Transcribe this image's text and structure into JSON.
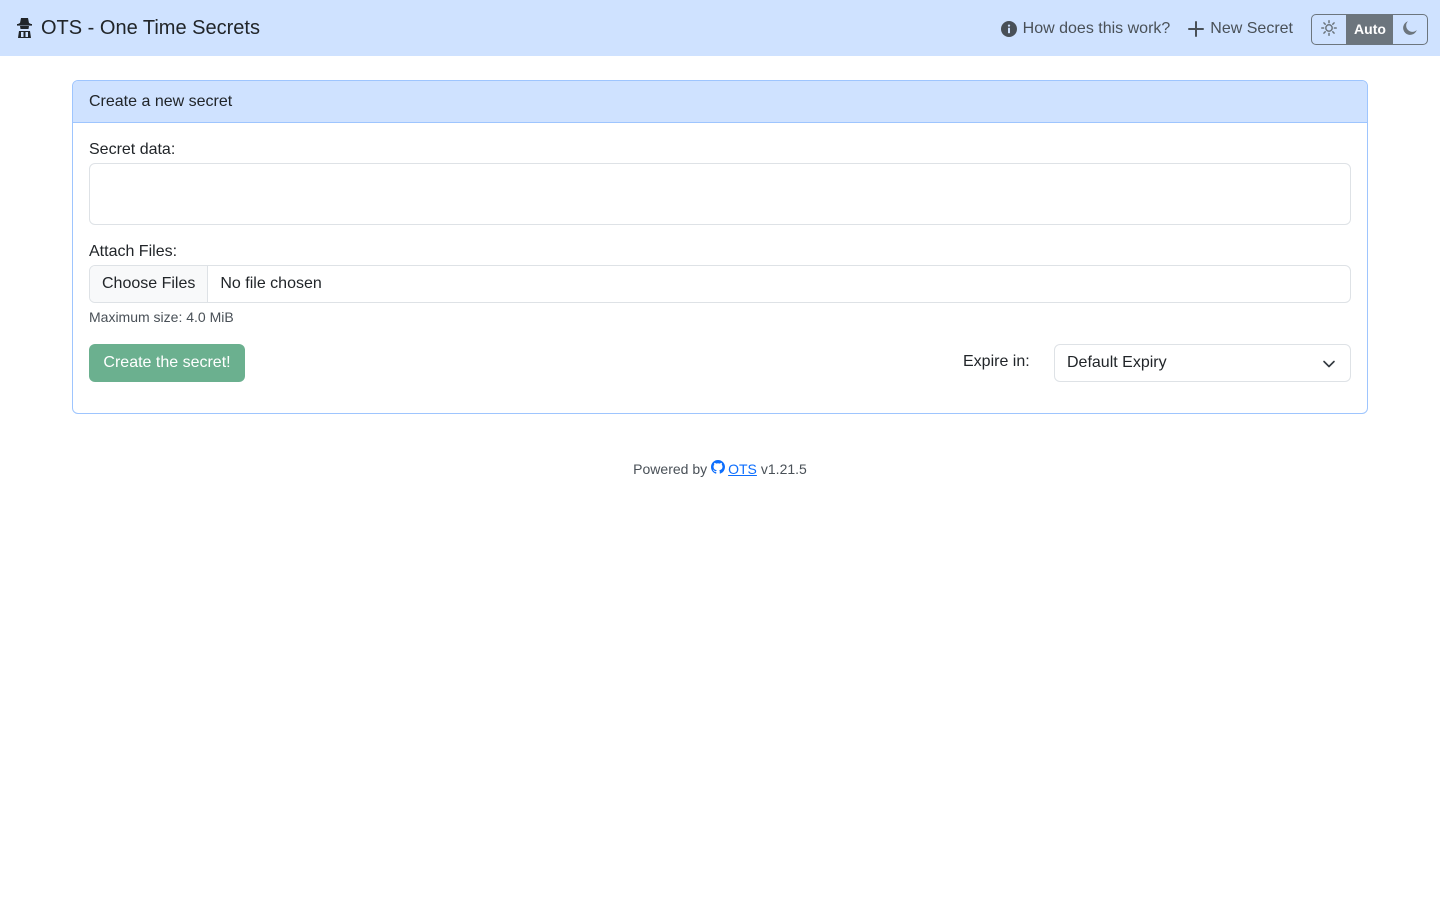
{
  "navbar": {
    "brand_icon": "spy-icon",
    "brand_title": "OTS - One Time Secrets",
    "how_label": "How does this work?",
    "how_icon": "info-circle-icon",
    "new_secret_label": "New Secret",
    "new_secret_icon": "plus-icon",
    "theme": {
      "light_icon": "sun-icon",
      "auto_label": "Auto",
      "dark_icon": "moon-icon",
      "selected": "Auto"
    }
  },
  "card": {
    "header": "Create a new secret",
    "secret_label": "Secret data:",
    "secret_value": "",
    "files_label": "Attach Files:",
    "choose_files_label": "Choose Files",
    "file_status": "No file chosen",
    "max_size": "Maximum size: 4.0 MiB",
    "create_label": "Create the secret!",
    "expire_label": "Expire in:",
    "expire_selected": "Default Expiry"
  },
  "footer": {
    "powered_by": "Powered by",
    "link_icon": "github-icon",
    "link_label": "OTS",
    "version": "v1.21.5"
  },
  "colors": {
    "navbar_bg": "#cfe2ff",
    "card_border": "#9ec5fe",
    "create_button": "#6bb08f",
    "link": "#0d6efd",
    "theme_active": "#6c757d"
  }
}
